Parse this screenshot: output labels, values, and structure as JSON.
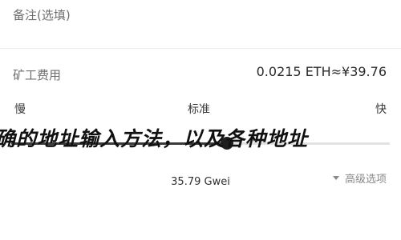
{
  "note": {
    "label": "备注(选填)"
  },
  "miner_fee": {
    "label": "矿工费用",
    "value": "0.0215 ETH≈¥39.76"
  },
  "speed": {
    "slow": "慢",
    "standard": "标准",
    "fast": "快",
    "level": 0.57
  },
  "overlay_banner": {
    "text": "确的地址输入方法，以及各种地址"
  },
  "gas": {
    "value": "35.79 Gwei"
  },
  "advanced_option": {
    "label": "高级选项",
    "icon": "caret-down-icon"
  },
  "colors": {
    "slider_active": "#3a3a3a",
    "slider_inactive": "#e2e2e2",
    "thumb": "#1f1f1f"
  }
}
